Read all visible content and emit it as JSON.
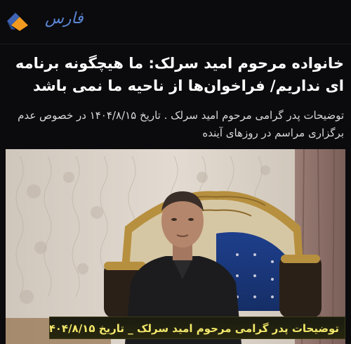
{
  "header": {
    "logo_text": "فارس",
    "brand_colors": {
      "logo_blue": "#3f63b4",
      "logo_orange": "#f29a1f",
      "logo_text": "#5b86d6"
    }
  },
  "article": {
    "headline": "خانواده مرحوم امید سرلک: ما هیچگونه برنامه ای نداریم/ فراخوان‌ها از ناحیه ما نمی باشد",
    "lead": "توضیحات پدر گرامی مرحوم امید سرلک . تاریخ ۱۴۰۴/۸/۱۵ در خصوص عدم برگزاری مراسم در روزهای آینده"
  },
  "video": {
    "caption": "توضیحات پدر گرامی مرحوم امید سرلک _ تاریخ ۱۴۰۴/۸/۱۵",
    "caption_color": "#f3e86a"
  }
}
